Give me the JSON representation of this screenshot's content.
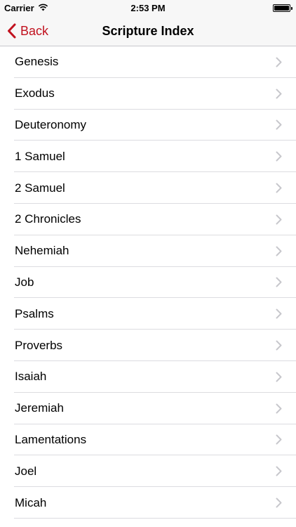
{
  "status_bar": {
    "carrier": "Carrier",
    "time": "2:53 PM"
  },
  "nav": {
    "back_label": "Back",
    "title": "Scripture Index"
  },
  "colors": {
    "accent": "#c1121f",
    "bar_background": "#f7f7f7",
    "separator": "#dcdce0",
    "chevron": "#c7c7cc"
  },
  "icons": {
    "back": "chevron-left-icon",
    "row": "chevron-right-icon",
    "wifi": "wifi-icon",
    "battery": "battery-icon"
  },
  "books": [
    "Genesis",
    "Exodus",
    "Deuteronomy",
    "1 Samuel",
    "2 Samuel",
    "2 Chronicles",
    "Nehemiah",
    "Job",
    "Psalms",
    "Proverbs",
    "Isaiah",
    "Jeremiah",
    "Lamentations",
    "Joel",
    "Micah"
  ]
}
